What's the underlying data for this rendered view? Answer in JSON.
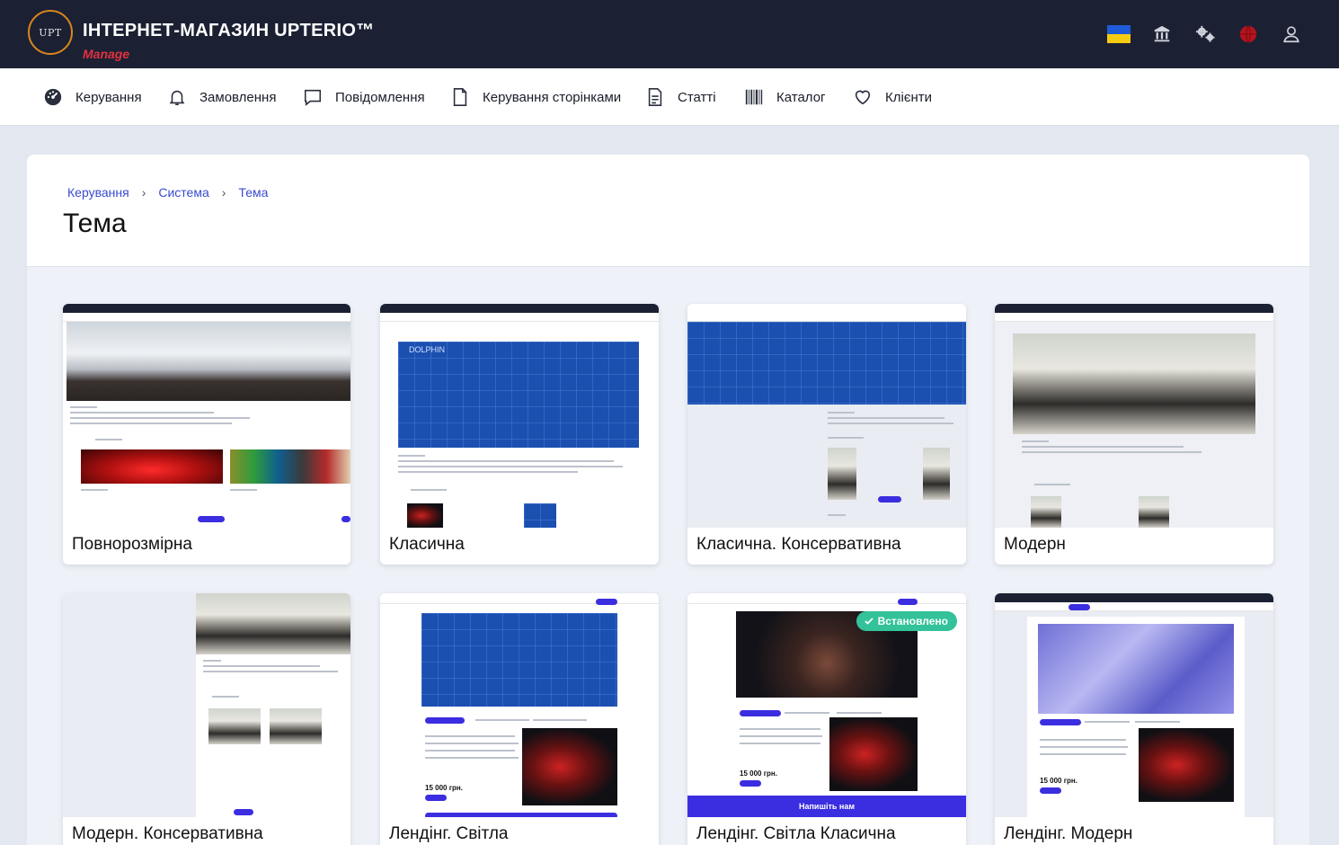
{
  "header": {
    "logo_text": "UPT",
    "title": "ІНТЕРНЕТ-МАГАЗИН UPTERIO™",
    "subtitle": "Manage",
    "icons": [
      "ukraine-flag-icon",
      "bank-icon",
      "settings-gears-icon",
      "globe-icon",
      "user-icon"
    ]
  },
  "nav": {
    "items": [
      {
        "label": "Керування",
        "icon": "dashboard-icon"
      },
      {
        "label": "Замовлення",
        "icon": "bell-icon"
      },
      {
        "label": "Повідомлення",
        "icon": "message-icon"
      },
      {
        "label": "Керування сторінками",
        "icon": "page-icon"
      },
      {
        "label": "Статті",
        "icon": "article-icon"
      },
      {
        "label": "Каталог",
        "icon": "barcode-icon"
      },
      {
        "label": "Клієнти",
        "icon": "heart-icon"
      }
    ]
  },
  "breadcrumb": [
    "Керування",
    "Система",
    "Тема"
  ],
  "page_title": "Тема",
  "themes": [
    {
      "name": "Повнорозмірна",
      "installed": false
    },
    {
      "name": "Класична",
      "installed": false
    },
    {
      "name": "Класична. Консервативна",
      "installed": false
    },
    {
      "name": "Модерн",
      "installed": false
    },
    {
      "name": "Модерн. Консервативна",
      "installed": false
    },
    {
      "name": "Лендінг. Світла",
      "installed": false
    },
    {
      "name": "Лендінг. Світла Класична",
      "installed": true
    },
    {
      "name": "Лендінг. Модерн",
      "installed": false
    }
  ],
  "installed_label": "Встановлено",
  "thumbnail_texts": {
    "dolphin": "DOLPHIN",
    "contact_banner": "Напишіть нам",
    "price": "15 000 грн."
  },
  "colors": {
    "topbar": "#1b2133",
    "accent": "#3a4bd1",
    "manage_red": "#e2313e",
    "installed_badge": "#33c29a"
  }
}
